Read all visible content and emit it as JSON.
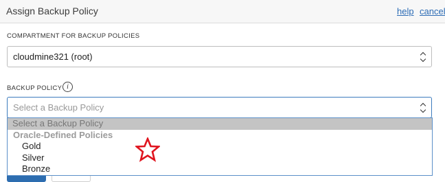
{
  "header": {
    "title": "Assign Backup Policy",
    "help_label": "help",
    "cancel_label": "cancel"
  },
  "compartment": {
    "label": "COMPARTMENT FOR BACKUP POLICIES",
    "value": "cloudmine321 (root)"
  },
  "backup_policy": {
    "label": "BACKUP POLICY",
    "placeholder": "Select a Backup Policy",
    "info_icon": "i",
    "options": {
      "placeholder_option": "Select a Backup Policy",
      "group_label": "Oracle-Defined Policies",
      "items": [
        "Gold",
        "Silver",
        "Bronze"
      ]
    }
  },
  "colors": {
    "link": "#2b6bb5",
    "focus_border": "#3c7bbd",
    "highlight": "#c4c4c4",
    "annotation_star": "#e0141e"
  }
}
